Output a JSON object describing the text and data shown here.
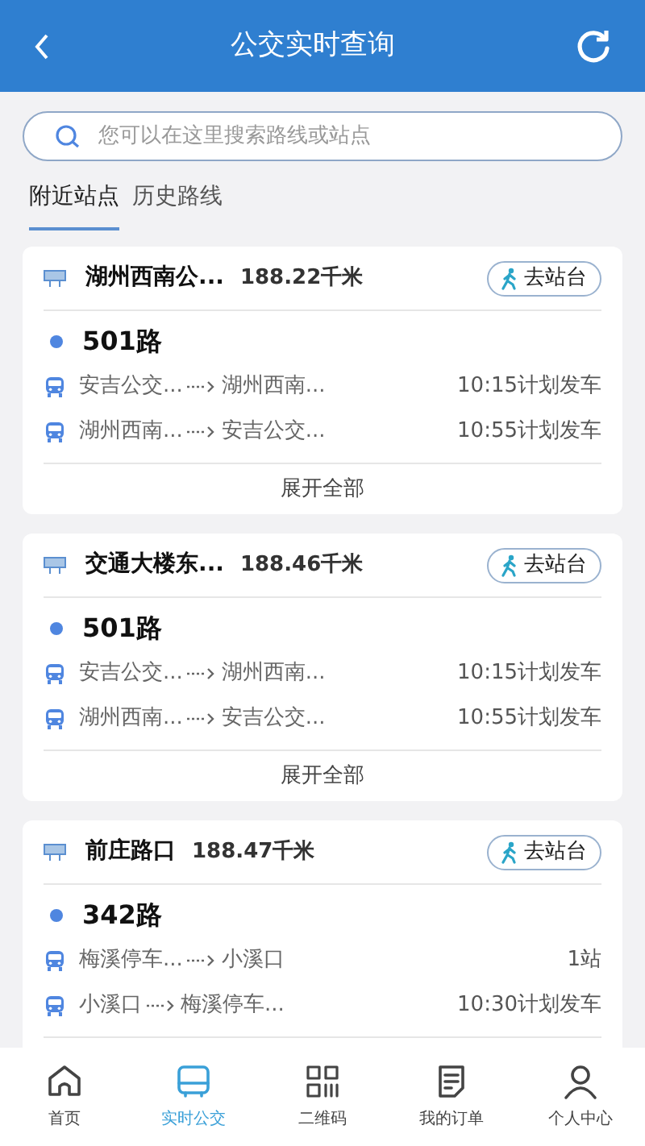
{
  "header": {
    "title": "公交实时查询"
  },
  "search": {
    "placeholder": "您可以在这里搜索路线或站点"
  },
  "tabs": [
    {
      "label": "附近站点",
      "selected": true
    },
    {
      "label": "历史路线",
      "selected": false
    }
  ],
  "stations": [
    {
      "name": "湖州西南公...",
      "distance": "188.22千米",
      "button": "去站台",
      "route": "501路",
      "trips": [
        {
          "from": "安吉公交...",
          "to": "湖州西南...",
          "info": "10:15计划发车"
        },
        {
          "from": "湖州西南...",
          "to": "安吉公交...",
          "info": "10:55计划发车"
        }
      ],
      "expand": "展开全部"
    },
    {
      "name": "交通大楼东...",
      "distance": "188.46千米",
      "button": "去站台",
      "route": "501路",
      "trips": [
        {
          "from": "安吉公交...",
          "to": "湖州西南...",
          "info": "10:15计划发车"
        },
        {
          "from": "湖州西南...",
          "to": "安吉公交...",
          "info": "10:55计划发车"
        }
      ],
      "expand": "展开全部"
    },
    {
      "name": "前庄路口",
      "distance": "188.47千米",
      "button": "去站台",
      "route": "342路",
      "trips": [
        {
          "from": "梅溪停车...",
          "to": "小溪口",
          "info": "1站"
        },
        {
          "from": "小溪口",
          "to": "梅溪停车...",
          "info": "10:30计划发车"
        }
      ]
    }
  ],
  "nav": [
    {
      "label": "首页",
      "kind": "home",
      "selected": false
    },
    {
      "label": "实时公交",
      "kind": "bus",
      "selected": true
    },
    {
      "label": "二维码",
      "kind": "qr",
      "selected": false
    },
    {
      "label": "我的订单",
      "kind": "order",
      "selected": false
    },
    {
      "label": "个人中心",
      "kind": "user",
      "selected": false
    }
  ]
}
